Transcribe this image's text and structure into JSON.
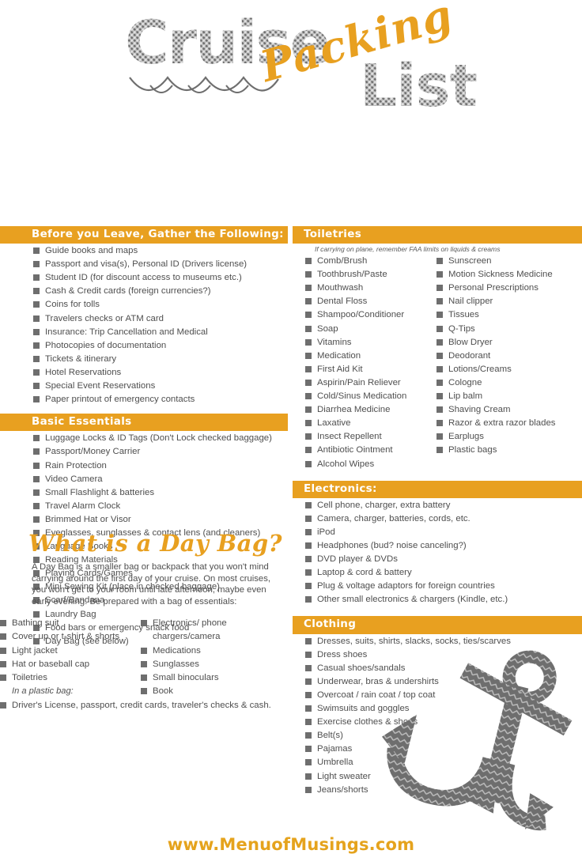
{
  "title": {
    "word1": "Cruise",
    "word2": "Packing",
    "word3": "List",
    "wave_icon": "wave-icon"
  },
  "colors": {
    "accent_orange": "#E8A020",
    "title_gray": "#6E6E6E",
    "body_text": "#4F4F4F",
    "footer_orange": "#E5A31D"
  },
  "sections": {
    "before_you_leave": {
      "heading": "Before you Leave, Gather the Following:",
      "items": [
        "Guide books and maps",
        "Passport and visa(s), Personal ID (Drivers license)",
        "Student ID (for discount access to museums etc.)",
        "Cash & Credit cards (foreign currencies?)",
        "Coins for tolls",
        "Travelers checks or ATM card",
        "Insurance: Trip Cancellation and Medical",
        "Photocopies of documentation",
        "Tickets & itinerary",
        "Hotel Reservations",
        "Special Event Reservations",
        "Paper printout of emergency contacts"
      ]
    },
    "basic_essentials": {
      "heading": "Basic Essentials",
      "items": [
        "Luggage Locks & ID Tags (Don't Lock checked baggage)",
        "Passport/Money Carrier",
        "Rain Protection",
        "Video Camera",
        "Small Flashlight & batteries",
        "Travel Alarm Clock",
        "Brimmed Hat or Visor",
        "Eyeglasses, sunglasses & contact lens (and cleaners)",
        "Language Books",
        "Reading Materials",
        "Playing Cards/Games",
        "Mini Sewing Kit (place in checked baggage)",
        "Scarf/Bandana",
        "Laundry Bag",
        "Food bars or emergency snack food",
        "Day Bag  (see below)"
      ]
    },
    "toiletries": {
      "heading": "Toiletries",
      "note": "If carrying on plane, remember FAA limits on liquids & creams",
      "column_a": [
        "Comb/Brush",
        "Toothbrush/Paste",
        "Mouthwash",
        "Dental Floss",
        "Shampoo/Conditioner",
        "Soap",
        "Vitamins",
        "Medication",
        "First Aid Kit",
        "Aspirin/Pain Reliever",
        "Cold/Sinus Medication",
        "Diarrhea Medicine",
        "Laxative",
        "Insect Repellent",
        "Antibiotic Ointment",
        "Alcohol Wipes"
      ],
      "column_b": [
        "Sunscreen",
        "Motion Sickness Medicine",
        "Personal Prescriptions",
        "Nail clipper",
        "Tissues",
        "Q-Tips",
        "Blow Dryer",
        "Deodorant",
        "Lotions/Creams",
        "Cologne",
        "Lip balm",
        "Shaving Cream",
        "Razor & extra razor blades",
        "Earplugs",
        "Plastic bags"
      ]
    },
    "electronics": {
      "heading": "Electronics:",
      "items": [
        "Cell phone, charger, extra battery",
        "Camera, charger, batteries, cords, etc.",
        "iPod",
        "Headphones (bud? noise canceling?)",
        "DVD player & DVDs",
        "Laptop & cord & battery",
        "Plug & voltage adaptors for foreign countries",
        "Other small electronics & chargers  (Kindle, etc.)"
      ]
    },
    "clothing": {
      "heading": "Clothing",
      "items": [
        "Dresses, suits, shirts, slacks, socks, ties/scarves",
        "Dress shoes",
        "Casual shoes/sandals",
        "Underwear, bras & undershirts",
        "Overcoat / rain coat / top coat",
        "Swimsuits and goggles",
        "Exercise clothes & shoes",
        "Belt(s)",
        "Pajamas",
        "Umbrella",
        "Light sweater",
        "Jeans/shorts"
      ]
    },
    "day_bag": {
      "heading": "What is a Day Bag?",
      "paragraph": "A Day Bag is a smaller bag or backpack that you won't mind carrying around the first day of your cruise. On most cruises, you won't get to your room until late afternoon, maybe even early evening. Be prepared with a bag of essentials:",
      "column_a": [
        "Bathing suit",
        "Cover up or t-shirt & shorts",
        "Light jacket",
        "Hat or baseball cap",
        "Toiletries"
      ],
      "column_a_note": "In a plastic bag:",
      "column_b": [
        "Electronics/ phone",
        "chargers/camera",
        "Medications",
        "Sunglasses",
        "Small binoculars",
        "Book"
      ],
      "final_item": "Driver's License, passport, credit cards, traveler's checks & cash."
    }
  },
  "artwork": {
    "anchor_icon": "anchor-icon"
  },
  "footer": {
    "url": "www.MenuofMusings.com"
  }
}
